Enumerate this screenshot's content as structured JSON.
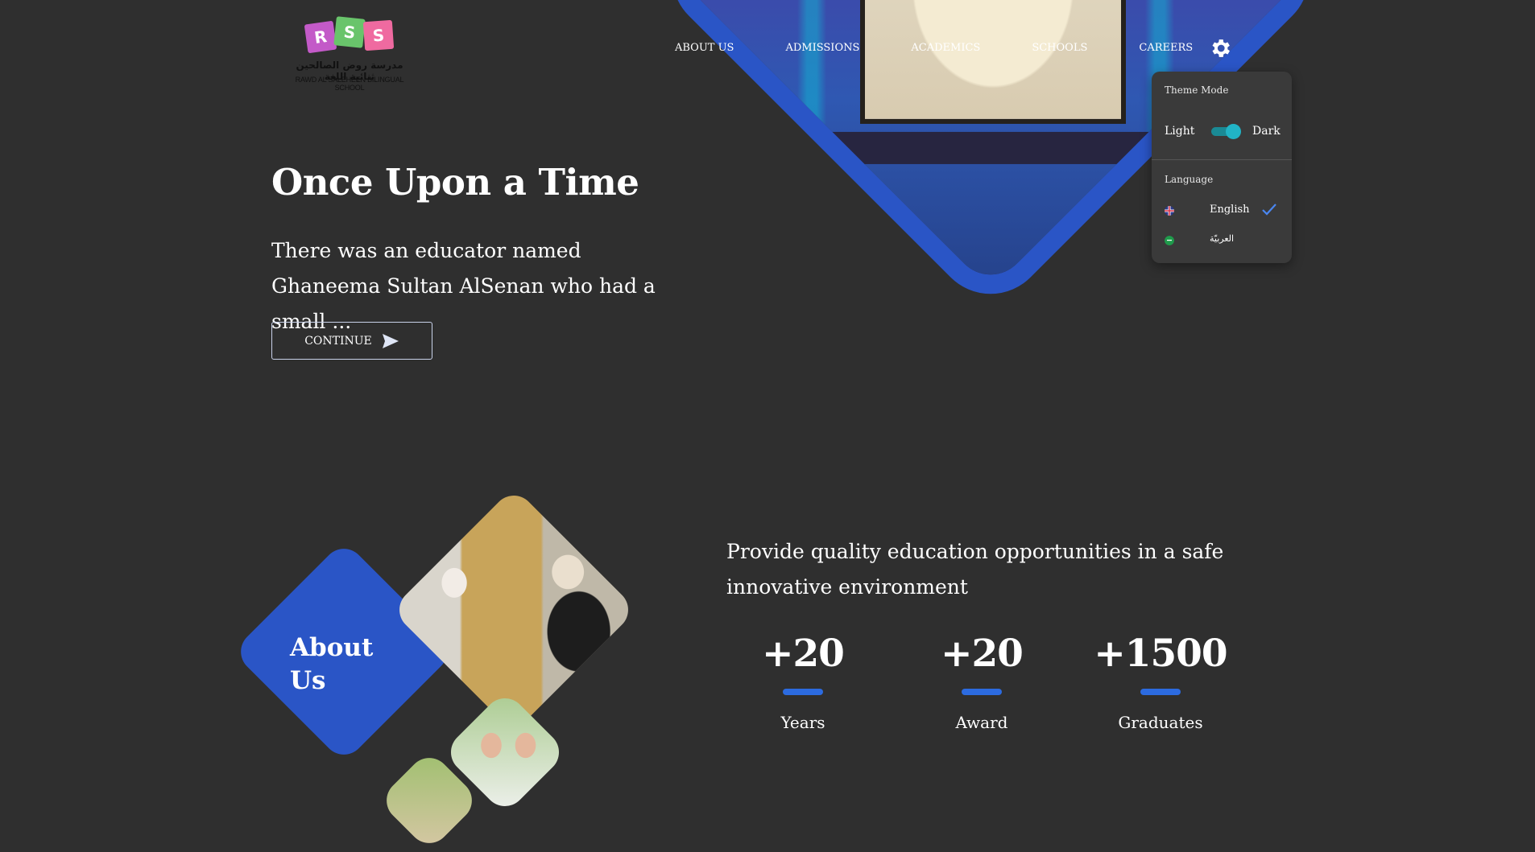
{
  "brand": {
    "logo_letters": [
      "R",
      "S",
      "S"
    ],
    "arabic_name": "مدرسة روض الصالحين ثنائية اللغة",
    "english_name": "RAWD AL SALEHEEN BILINGUAL SCHOOL"
  },
  "nav": {
    "items": [
      "ABOUT US",
      "ADMISSIONS",
      "ACADEMICS",
      "SCHOOLS",
      "CAREERS"
    ]
  },
  "settings": {
    "theme_title": "Theme Mode",
    "light_label": "Light",
    "dark_label": "Dark",
    "dark_enabled": true,
    "language_title": "Language",
    "languages": [
      {
        "label": "English",
        "selected": true
      },
      {
        "label": "العربيّة",
        "selected": false
      }
    ]
  },
  "hero": {
    "title": "Once Upon a Time",
    "subtitle": "There was an educator named Ghaneema Sultan AlSenan who had a small ...",
    "cta_label": "CONTINUE"
  },
  "about": {
    "title_line1": "About",
    "title_line2": "Us",
    "mission": "Provide quality education opportunities in a safe innovative environment",
    "stats": [
      {
        "value": "+20",
        "label": "Years"
      },
      {
        "value": "+20",
        "label": "Award"
      },
      {
        "value": "+1500",
        "label": "Graduates"
      }
    ]
  },
  "colors": {
    "background": "#2f2f2f",
    "accent_blue": "#2a55c6",
    "toggle_teal": "#21b4c6",
    "stat_bar": "#2c6be0"
  }
}
